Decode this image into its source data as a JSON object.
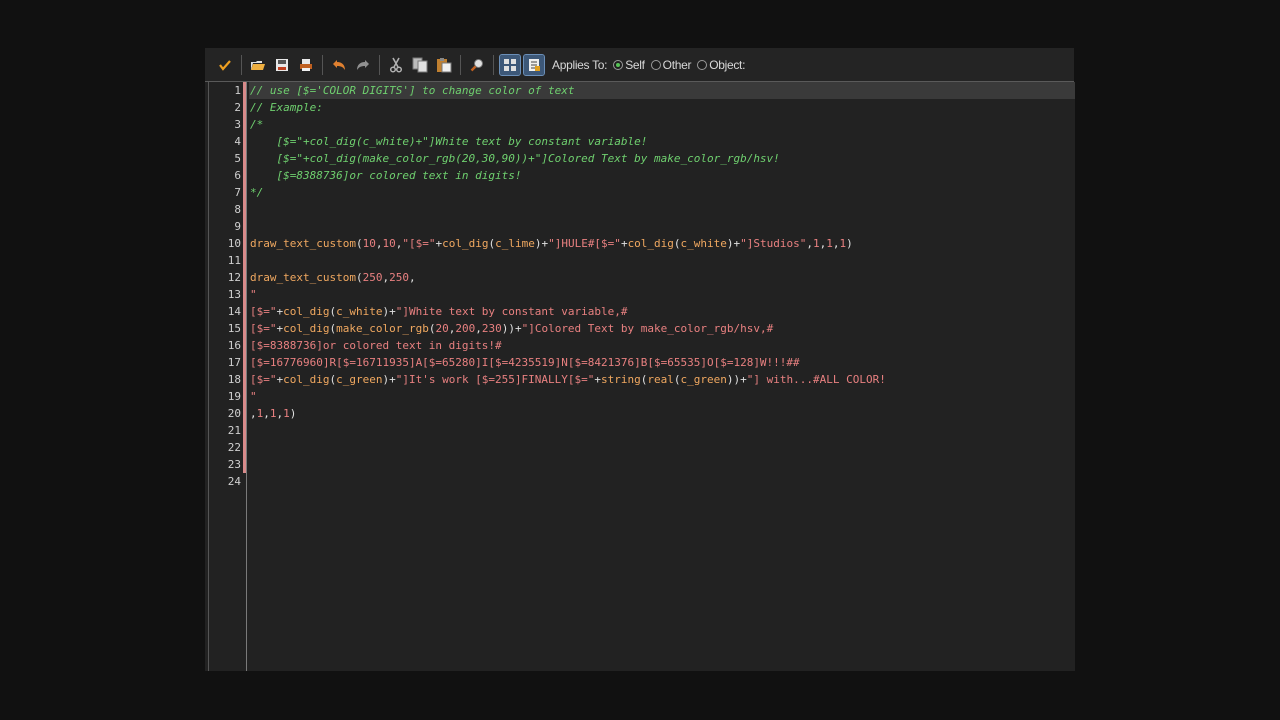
{
  "toolbar": {
    "buttons": [
      {
        "name": "ok-button",
        "icon": "checkmark-icon"
      },
      {
        "name": "load-button",
        "icon": "folder-open-icon"
      },
      {
        "name": "save-button",
        "icon": "save-icon"
      },
      {
        "name": "print-button",
        "icon": "print-icon"
      },
      {
        "name": "undo-button",
        "icon": "undo-icon"
      },
      {
        "name": "redo-button",
        "icon": "redo-icon"
      },
      {
        "name": "cut-button",
        "icon": "scissors-icon"
      },
      {
        "name": "copy-button",
        "icon": "copy-icon"
      },
      {
        "name": "paste-button",
        "icon": "paste-icon"
      },
      {
        "name": "find-button",
        "icon": "magnifier-icon"
      },
      {
        "name": "code-view-button",
        "icon": "code-view-icon"
      },
      {
        "name": "script-button",
        "icon": "script-icon"
      }
    ],
    "applies_to_label": "Applies To:",
    "options": [
      {
        "label": "Self",
        "checked": true
      },
      {
        "label": "Other",
        "checked": false
      },
      {
        "label": "Object:",
        "checked": false
      }
    ]
  },
  "editor": {
    "current_line": 1,
    "modified_lines": [
      1,
      2,
      3,
      4,
      5,
      6,
      7,
      8,
      9,
      10,
      11,
      12,
      13,
      14,
      15,
      16,
      17,
      18,
      19,
      20,
      21,
      22,
      23
    ],
    "lines": [
      [
        [
          "com",
          "// use [$='COLOR DIGITS'] to change color of text"
        ]
      ],
      [
        [
          "com",
          "// Example:"
        ]
      ],
      [
        [
          "com",
          "/*"
        ]
      ],
      [
        [
          "com",
          "    [$=\"+col_dig(c_white)+\"]White text by constant variable!"
        ]
      ],
      [
        [
          "com",
          "    [$=\"+col_dig(make_color_rgb(20,30,90))+\"]Colored Text by make_color_rgb/hsv!"
        ]
      ],
      [
        [
          "com",
          "    [$=8388736]or colored text in digits!"
        ]
      ],
      [
        [
          "com",
          "*/"
        ]
      ],
      [],
      [],
      [
        [
          "fn",
          "draw_text_custom"
        ],
        [
          "sym",
          "("
        ],
        [
          "num",
          "10"
        ],
        [
          "sym",
          ","
        ],
        [
          "num",
          "10"
        ],
        [
          "sym",
          ","
        ],
        [
          "str",
          "\"[$=\""
        ],
        [
          "sym",
          "+"
        ],
        [
          "fn",
          "col_dig"
        ],
        [
          "sym",
          "("
        ],
        [
          "fn",
          "c_lime"
        ],
        [
          "sym",
          ")+"
        ],
        [
          "str",
          "\"]HULE#[$=\""
        ],
        [
          "sym",
          "+"
        ],
        [
          "fn",
          "col_dig"
        ],
        [
          "sym",
          "("
        ],
        [
          "fn",
          "c_white"
        ],
        [
          "sym",
          ")+"
        ],
        [
          "str",
          "\"]Studios\""
        ],
        [
          "sym",
          ","
        ],
        [
          "num",
          "1"
        ],
        [
          "sym",
          ","
        ],
        [
          "num",
          "1"
        ],
        [
          "sym",
          ","
        ],
        [
          "num",
          "1"
        ],
        [
          "sym",
          ")"
        ]
      ],
      [],
      [
        [
          "fn",
          "draw_text_custom"
        ],
        [
          "sym",
          "("
        ],
        [
          "num",
          "250"
        ],
        [
          "sym",
          ","
        ],
        [
          "num",
          "250"
        ],
        [
          "sym",
          ","
        ]
      ],
      [
        [
          "str",
          "\""
        ]
      ],
      [
        [
          "str",
          "[$=\""
        ],
        [
          "sym",
          "+"
        ],
        [
          "fn",
          "col_dig"
        ],
        [
          "sym",
          "("
        ],
        [
          "fn",
          "c_white"
        ],
        [
          "sym",
          ")+"
        ],
        [
          "str",
          "\"]White text by constant variable,#"
        ]
      ],
      [
        [
          "str",
          "[$=\""
        ],
        [
          "sym",
          "+"
        ],
        [
          "fn",
          "col_dig"
        ],
        [
          "sym",
          "("
        ],
        [
          "fn",
          "make_color_rgb"
        ],
        [
          "sym",
          "("
        ],
        [
          "num",
          "20"
        ],
        [
          "sym",
          ","
        ],
        [
          "num",
          "200"
        ],
        [
          "sym",
          ","
        ],
        [
          "num",
          "230"
        ],
        [
          "sym",
          "))+"
        ],
        [
          "str",
          "\"]Colored Text by make_color_rgb/hsv,#"
        ]
      ],
      [
        [
          "str",
          "[$=8388736]or colored text in digits!#"
        ]
      ],
      [
        [
          "str",
          "[$=16776960]R[$=16711935]A[$=65280]I[$=4235519]N[$=8421376]B[$=65535]O[$=128]W!!!##"
        ]
      ],
      [
        [
          "str",
          "[$=\""
        ],
        [
          "sym",
          "+"
        ],
        [
          "fn",
          "col_dig"
        ],
        [
          "sym",
          "("
        ],
        [
          "fn",
          "c_green"
        ],
        [
          "sym",
          ")+"
        ],
        [
          "str",
          "\"]It's work [$=255]FINALLY[$=\""
        ],
        [
          "sym",
          "+"
        ],
        [
          "fn",
          "string"
        ],
        [
          "sym",
          "("
        ],
        [
          "fn",
          "real"
        ],
        [
          "sym",
          "("
        ],
        [
          "fn",
          "c_green"
        ],
        [
          "sym",
          "))+"
        ],
        [
          "str",
          "\"] with...#ALL COLOR!"
        ]
      ],
      [
        [
          "str",
          "\""
        ]
      ],
      [
        [
          "sym",
          ","
        ],
        [
          "num",
          "1"
        ],
        [
          "sym",
          ","
        ],
        [
          "num",
          "1"
        ],
        [
          "sym",
          ","
        ],
        [
          "num",
          "1"
        ],
        [
          "sym",
          ")"
        ]
      ],
      [],
      [],
      [],
      []
    ]
  },
  "colors": {
    "comment": "#6fd06f",
    "function": "#f0a860",
    "number": "#e88080",
    "string": "#e88080",
    "symbol": "#e0e0e0"
  }
}
